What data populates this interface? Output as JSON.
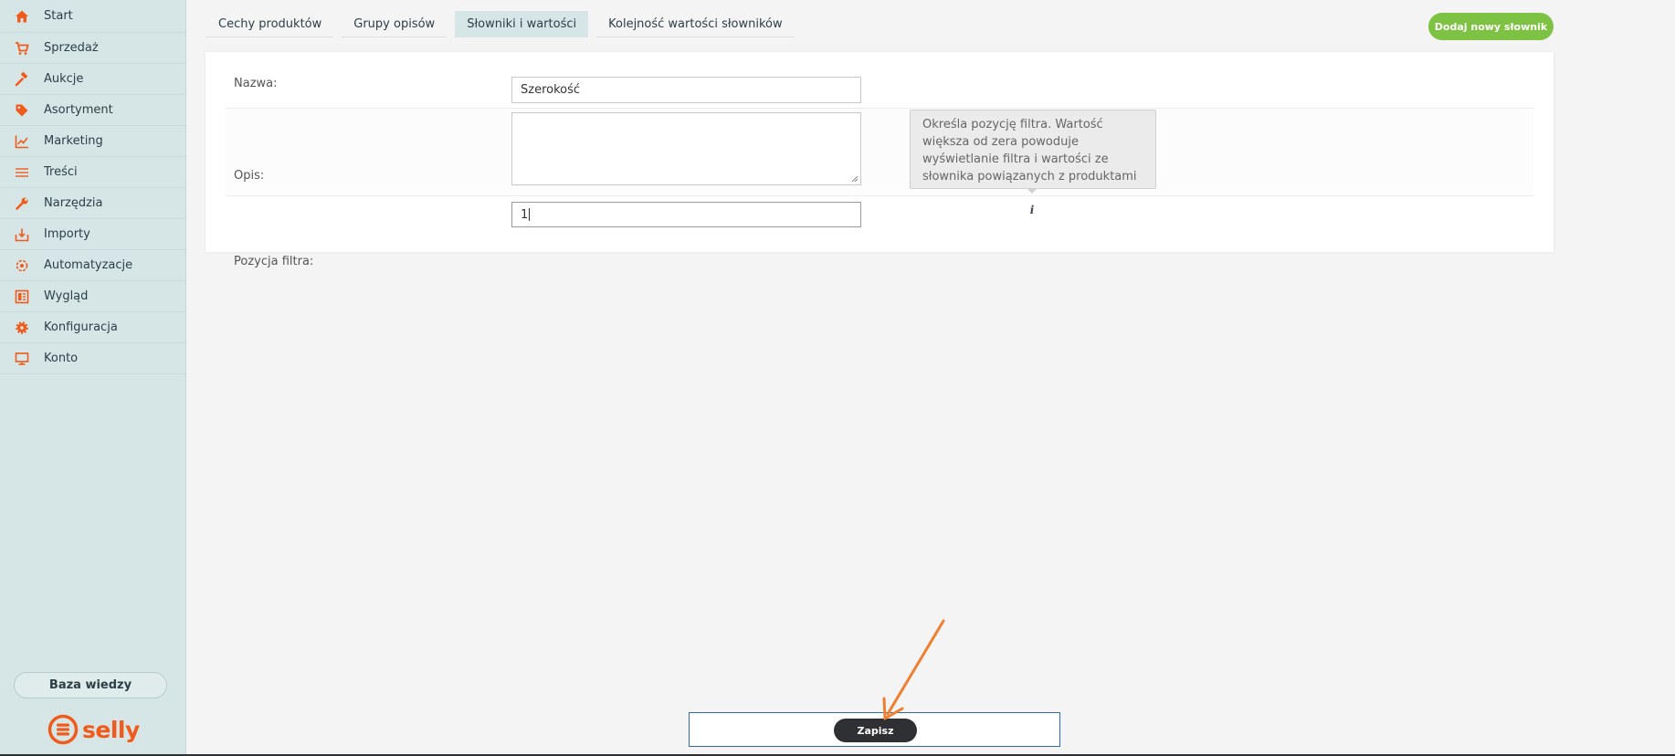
{
  "sidebar": {
    "items": [
      {
        "label": "Start",
        "icon": "home-icon"
      },
      {
        "label": "Sprzedaż",
        "icon": "cart-icon"
      },
      {
        "label": "Aukcje",
        "icon": "gavel-icon"
      },
      {
        "label": "Asortyment",
        "icon": "tag-icon"
      },
      {
        "label": "Marketing",
        "icon": "chart-line-icon"
      },
      {
        "label": "Treści",
        "icon": "lines-icon"
      },
      {
        "label": "Narzędzia",
        "icon": "wrench-icon"
      },
      {
        "label": "Importy",
        "icon": "import-icon"
      },
      {
        "label": "Automatyzacje",
        "icon": "gear-cycle-icon"
      },
      {
        "label": "Wygląd",
        "icon": "layout-icon"
      },
      {
        "label": "Konfiguracja",
        "icon": "cog-icon"
      },
      {
        "label": "Konto",
        "icon": "monitor-icon"
      }
    ],
    "knowledge_base_label": "Baza wiedzy",
    "logo_text": "selly"
  },
  "tabs": [
    {
      "label": "Cechy produktów",
      "active": false
    },
    {
      "label": "Grupy opisów",
      "active": false
    },
    {
      "label": "Słowniki i wartości",
      "active": true
    },
    {
      "label": "Kolejność wartości słowników",
      "active": false
    }
  ],
  "add_button_label": "Dodaj nowy słownik",
  "form": {
    "name_label": "Nazwa:",
    "name_value": "Szerokość",
    "description_label": "Opis:",
    "description_value": "",
    "position_label": "Pozycja filtra:",
    "position_value": "1"
  },
  "tooltip_text": "Określa pozycję filtra. Wartość większa od zera powoduje wyświetlanie filtra i wartości ze słownika powiązanych z produktami",
  "save_label": "Zapisz",
  "colors": {
    "accent_orange": "#f05a1a",
    "add_green": "#7dc242",
    "sidebar_bg": "#d6e6e7",
    "save_dark": "#2e3033",
    "annotation_arrow": "#ef7f2e"
  }
}
